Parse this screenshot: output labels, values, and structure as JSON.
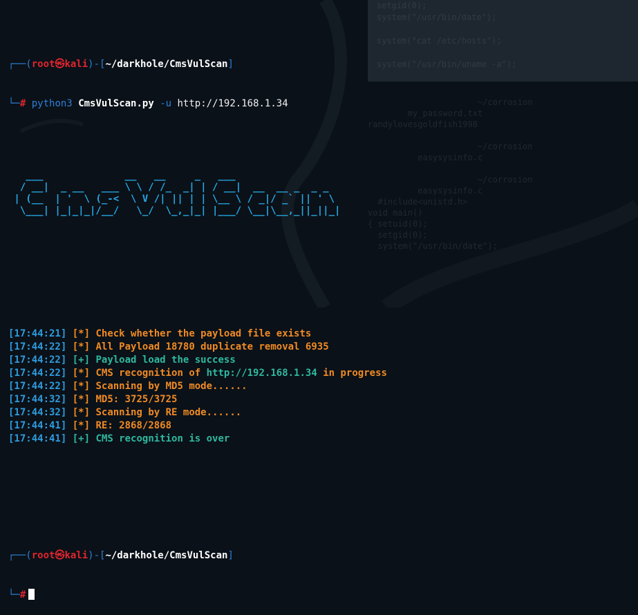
{
  "prompt1": {
    "top_corner": "┌──(",
    "user": "root",
    "at_symbol": "㉿",
    "host": "kali",
    "sep": ")-[",
    "path": "~/darkhole/CmsVulScan",
    "close": "]",
    "bottom_corner": "└─",
    "hash": "#"
  },
  "command": {
    "program": "python3",
    "script": "CmsVulScan.py",
    "flag": "-u",
    "url": "http://192.168.1.34"
  },
  "banner_art": "   ___              __   __     _   ___                \n  / __|  _ __   ___ \\ \\ / /_  _| | / __|  __  __ _  _ _ \n | (__  | '  \\ (_-<  \\ V /| || | | \\__ \\ / _|/ _` || ' \\\n  \\___| |_|_|_|/__/   \\_/  \\_,_|_| |___/ \\__|\\__,_||_||_|",
  "log_lines": [
    {
      "time": "[17:44:21]",
      "tag": "[*]",
      "msg": "Check whether the payload file exists",
      "link": "",
      "tail": "",
      "color": "orange"
    },
    {
      "time": "[17:44:22]",
      "tag": "[*]",
      "msg": "All Payload 18780 duplicate removal 6935",
      "link": "",
      "tail": "",
      "color": "orange"
    },
    {
      "time": "[17:44:22]",
      "tag": "[+]",
      "msg": "Payload load the success",
      "link": "",
      "tail": "",
      "color": "green"
    },
    {
      "time": "[17:44:22]",
      "tag": "[*]",
      "msg": "CMS recognition of ",
      "link": "http://192.168.1.34",
      "tail": " in progress",
      "color": "orange"
    },
    {
      "time": "[17:44:22]",
      "tag": "[*]",
      "msg": "Scanning by MD5 mode......",
      "link": "",
      "tail": "",
      "color": "orange"
    },
    {
      "time": "[17:44:32]",
      "tag": "[*]",
      "msg": "MD5: 3725/3725",
      "link": "",
      "tail": "",
      "color": "orange"
    },
    {
      "time": "[17:44:32]",
      "tag": "[*]",
      "msg": "Scanning by RE mode......",
      "link": "",
      "tail": "",
      "color": "orange"
    },
    {
      "time": "[17:44:41]",
      "tag": "[*]",
      "msg": "RE: 2868/2868",
      "link": "",
      "tail": "",
      "color": "orange"
    },
    {
      "time": "[17:44:41]",
      "tag": "[+]",
      "msg": "CMS recognition is over",
      "link": "",
      "tail": "",
      "color": "green"
    }
  ],
  "prompt2": {
    "top_corner": "┌──(",
    "user": "root",
    "at_symbol": "㉿",
    "host": "kali",
    "sep": ")-[",
    "path": "~/darkhole/CmsVulScan",
    "close": "]",
    "bottom_corner": "└─",
    "hash": "#"
  },
  "background_text": {
    "upper": "setgid(0);\nsystem(\"/usr/bin/date\");\n\nsystem(\"cat /etc/hosts\");\n\nsystem(\"/usr/bin/uname -a\");",
    "lower": "                      ~/corrosion\n        my_password.txt\nrandylovesgoldfish1998\n\n                      ~/corrosion\n          easysysinfo.c\n\n                      ~/corrosion\n          easysysinfo.c\n  #include<unistd.h>\nvoid main()\n{ setuid(0);\n  setgid(0);\n  system(\"/usr/bin/date\");"
  },
  "colors": {
    "background": "#0a1118",
    "prompt_blue": "#2d7fd6",
    "root_red": "#e0252e",
    "timestamp": "#2f9cdf",
    "info_orange": "#f08a24",
    "success_green": "#2fb8a0",
    "banner_cyan": "#27a8e6"
  }
}
